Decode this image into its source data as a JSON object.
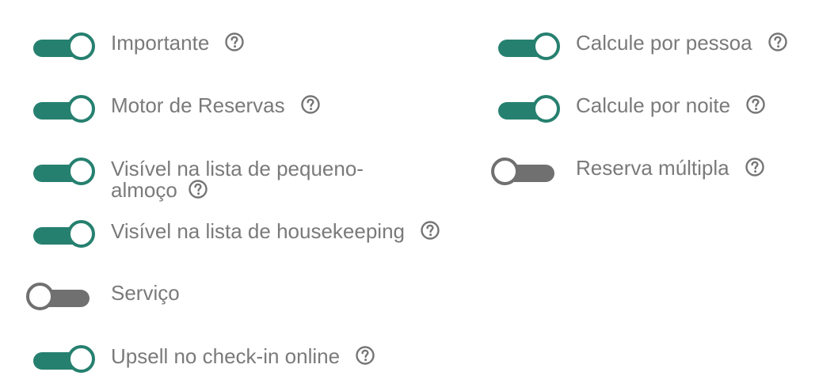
{
  "left_column": [
    {
      "label": "Importante",
      "state": "on",
      "help": true
    },
    {
      "label": "Motor de Reservas",
      "state": "on",
      "help": true
    },
    {
      "label_line1": "Visível na lista de pequeno-",
      "label_line2": "almoço",
      "state": "on",
      "help": true
    },
    {
      "label": "Visível na lista de housekeeping",
      "state": "on",
      "help": true
    },
    {
      "label": "Serviço",
      "state": "off",
      "help": false
    },
    {
      "label": "Upsell no check-in online",
      "state": "on",
      "help": true
    }
  ],
  "right_column": [
    {
      "label": "Calcule por pessoa",
      "state": "on",
      "help": true
    },
    {
      "label": "Calcule por noite",
      "state": "on",
      "help": true
    },
    {
      "label": "Reserva múltipla",
      "state": "off",
      "help": true
    }
  ],
  "colors": {
    "on_track": "#26806f",
    "off_track": "#707070",
    "label_text": "#7a7a7a",
    "help_icon": "#757575"
  },
  "icons": {
    "help": "question-circle-icon"
  }
}
